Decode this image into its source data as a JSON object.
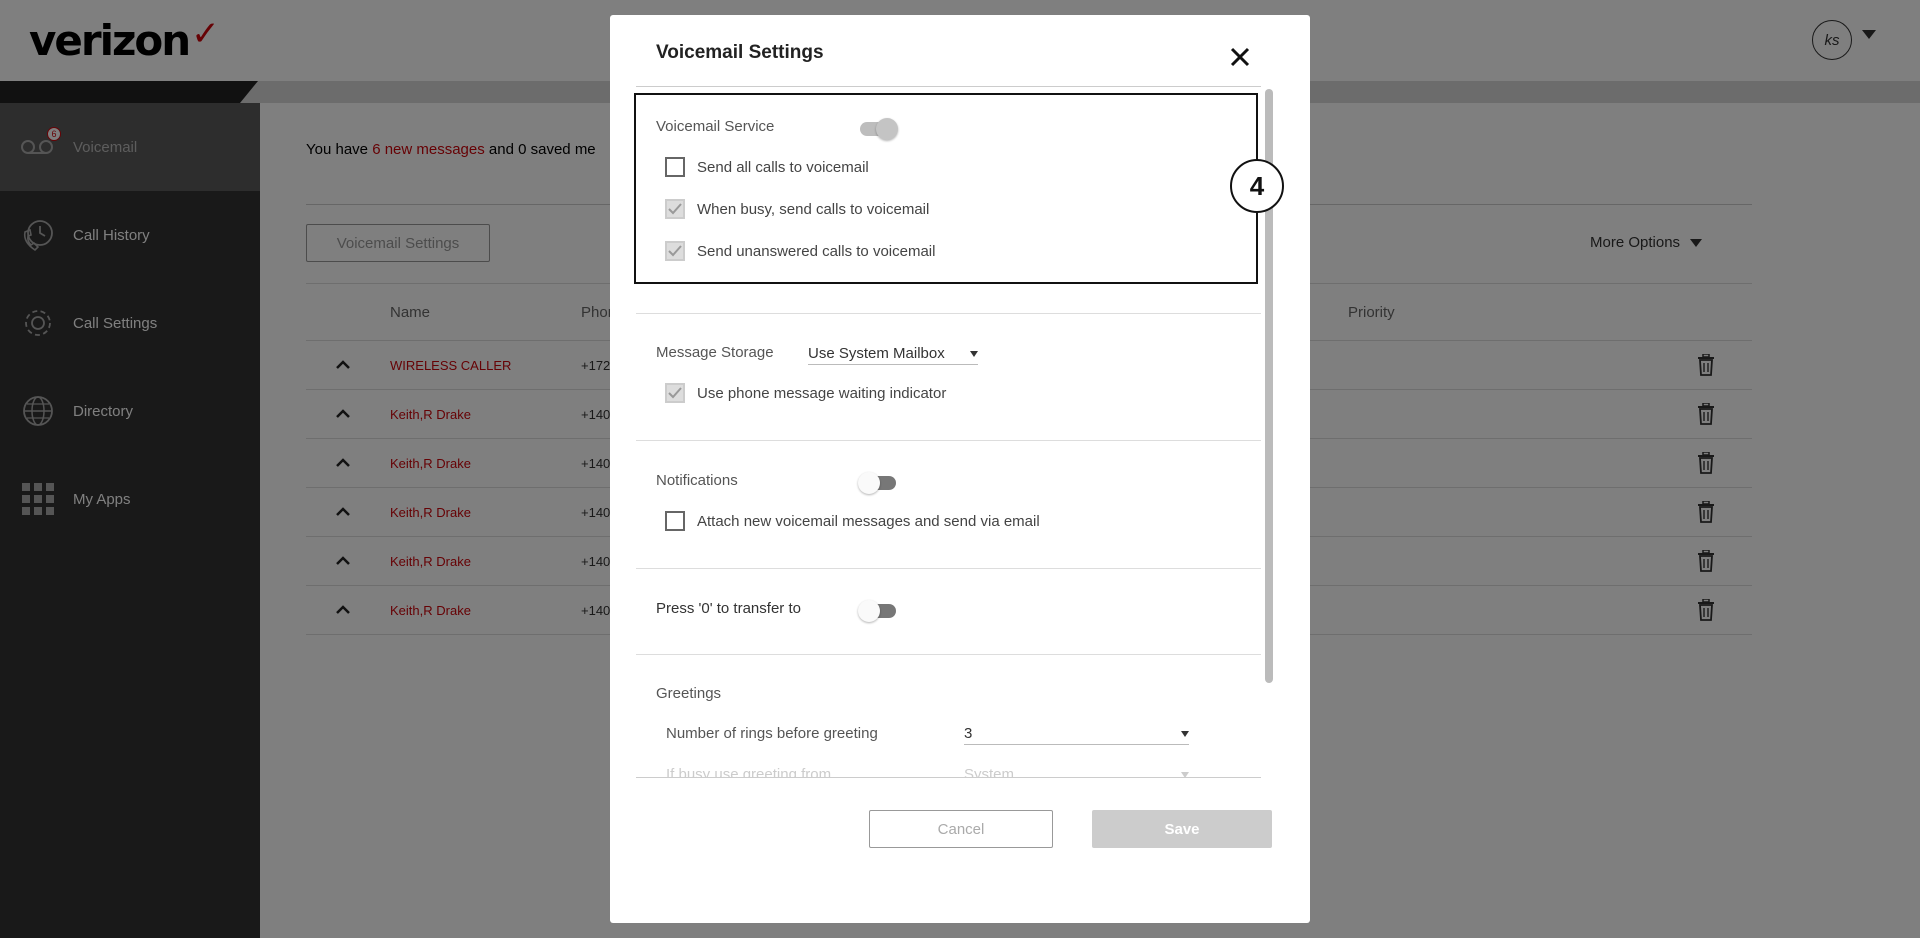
{
  "app": {
    "logo_text": "verizon",
    "avatar_initials": "ks"
  },
  "sidebar": {
    "items": [
      {
        "label": "Voicemail",
        "icon": "voicemail-icon",
        "badge": "6",
        "active": true
      },
      {
        "label": "Call History",
        "icon": "call-history-icon"
      },
      {
        "label": "Call Settings",
        "icon": "gear-icon"
      },
      {
        "label": "Directory",
        "icon": "globe-icon"
      },
      {
        "label": "My Apps",
        "icon": "apps-grid-icon"
      }
    ]
  },
  "main": {
    "summary_prefix": "You have ",
    "summary_new_link": "6 new messages",
    "summary_suffix": " and 0 saved me",
    "voicemail_settings_button": "Voicemail Settings",
    "more_options": "More Options",
    "table": {
      "columns": {
        "name": "Name",
        "phone": "Phon",
        "priority": "Priority"
      },
      "rows": [
        {
          "name": "WIRELESS CALLER",
          "phone": "+172"
        },
        {
          "name": "Keith,R Drake",
          "phone": "+140"
        },
        {
          "name": "Keith,R Drake",
          "phone": "+140"
        },
        {
          "name": "Keith,R Drake",
          "phone": "+140"
        },
        {
          "name": "Keith,R Drake",
          "phone": "+140"
        },
        {
          "name": "Keith,R Drake",
          "phone": "+140"
        }
      ]
    }
  },
  "modal": {
    "title": "Voicemail Settings",
    "voicemail_service": {
      "label": "Voicemail Service",
      "enabled": true,
      "send_all": {
        "label": "Send all calls to voicemail",
        "checked": false
      },
      "when_busy": {
        "label": "When busy, send calls to voicemail",
        "checked": true
      },
      "unanswered": {
        "label": "Send unanswered calls to voicemail",
        "checked": true
      }
    },
    "message_storage": {
      "label": "Message Storage",
      "value": "Use System Mailbox",
      "waiting_indicator": {
        "label": "Use phone message waiting indicator",
        "checked": true
      }
    },
    "notifications": {
      "label": "Notifications",
      "enabled": false,
      "attach": {
        "label": "Attach new voicemail messages and send via email",
        "checked": false
      }
    },
    "transfer": {
      "label": "Press '0' to transfer to",
      "enabled": false
    },
    "greetings": {
      "label": "Greetings",
      "rings_label": "Number of rings before greeting",
      "rings_value": "3",
      "busy_label": "If busy use greeting from",
      "busy_value": "System"
    },
    "cancel_button": "Cancel",
    "save_button": "Save",
    "step_number": "4"
  },
  "colors": {
    "brand_red": "#cd040b",
    "sidebar_dark": "#333333"
  }
}
